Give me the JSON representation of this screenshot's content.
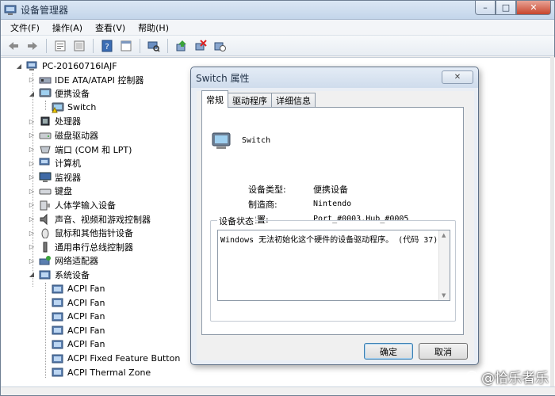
{
  "window": {
    "title": "设备管理器",
    "buttons": {
      "minimize": "–",
      "maximize": "□",
      "close": "✕"
    }
  },
  "menu": [
    "文件(F)",
    "操作(A)",
    "查看(V)",
    "帮助(H)"
  ],
  "toolbar_icons": [
    "back-icon",
    "forward-icon",
    "properties-icon",
    "view-icon",
    "help-icon",
    "console-icon",
    "scan-icon",
    "update-driver-icon",
    "disable-icon",
    "uninstall-icon"
  ],
  "tree": {
    "root": "PC-20160716IAJF",
    "items": [
      {
        "label": "IDE ATA/ATAPI 控制器",
        "icon": "ide-controller-icon",
        "level": 1,
        "expander": "▷"
      },
      {
        "label": "便携设备",
        "icon": "portable-device-icon",
        "level": 1,
        "expander": "◢"
      },
      {
        "label": "Switch",
        "icon": "switch-warning-icon",
        "level": 2,
        "expander": ""
      },
      {
        "label": "处理器",
        "icon": "processor-icon",
        "level": 1,
        "expander": "▷"
      },
      {
        "label": "磁盘驱动器",
        "icon": "disk-drive-icon",
        "level": 1,
        "expander": "▷"
      },
      {
        "label": "端口 (COM 和 LPT)",
        "icon": "port-icon",
        "level": 1,
        "expander": "▷"
      },
      {
        "label": "计算机",
        "icon": "computer-icon",
        "level": 1,
        "expander": "▷"
      },
      {
        "label": "监视器",
        "icon": "monitor-icon",
        "level": 1,
        "expander": "▷"
      },
      {
        "label": "键盘",
        "icon": "keyboard-icon",
        "level": 1,
        "expander": "▷"
      },
      {
        "label": "人体学输入设备",
        "icon": "hid-icon",
        "level": 1,
        "expander": "▷"
      },
      {
        "label": "声音、视频和游戏控制器",
        "icon": "sound-icon",
        "level": 1,
        "expander": "▷"
      },
      {
        "label": "鼠标和其他指针设备",
        "icon": "mouse-icon",
        "level": 1,
        "expander": "▷"
      },
      {
        "label": "通用串行总线控制器",
        "icon": "usb-icon",
        "level": 1,
        "expander": "▷"
      },
      {
        "label": "网络适配器",
        "icon": "network-adapter-icon",
        "level": 1,
        "expander": "▷"
      },
      {
        "label": "系统设备",
        "icon": "system-device-icon",
        "level": 1,
        "expander": "◢"
      },
      {
        "label": "ACPI Fan",
        "icon": "system-device-icon",
        "level": 2,
        "expander": ""
      },
      {
        "label": "ACPI Fan",
        "icon": "system-device-icon",
        "level": 2,
        "expander": ""
      },
      {
        "label": "ACPI Fan",
        "icon": "system-device-icon",
        "level": 2,
        "expander": ""
      },
      {
        "label": "ACPI Fan",
        "icon": "system-device-icon",
        "level": 2,
        "expander": ""
      },
      {
        "label": "ACPI Fan",
        "icon": "system-device-icon",
        "level": 2,
        "expander": ""
      },
      {
        "label": "ACPI Fixed Feature Button",
        "icon": "system-device-icon",
        "level": 2,
        "expander": ""
      },
      {
        "label": "ACPI Thermal Zone",
        "icon": "system-device-icon",
        "level": 2,
        "expander": ""
      }
    ]
  },
  "dialog": {
    "title": "Switch 属性",
    "close": "✕",
    "tabs": [
      "常规",
      "驱动程序",
      "详细信息"
    ],
    "device_name": "Switch",
    "props": [
      {
        "label": "设备类型:",
        "value": "便携设备"
      },
      {
        "label": "制造商:",
        "value": "Nintendo"
      },
      {
        "label": "位置:",
        "value": "Port_#0003.Hub_#0005"
      }
    ],
    "status_group": "设备状态",
    "status_text": "Windows 无法初始化这个硬件的设备驱动程序。 (代码 37)",
    "ok": "确定",
    "cancel": "取消"
  },
  "watermark": "@恰乐者乐"
}
